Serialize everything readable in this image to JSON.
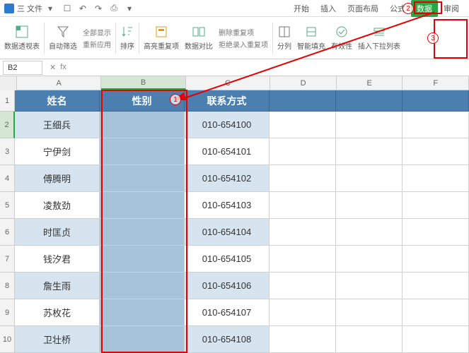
{
  "topbar": {
    "file_menu": "三 文件",
    "tabs": [
      "开始",
      "插入",
      "页面布局",
      "公式",
      "数据",
      "审阅"
    ],
    "active_tab": "数据"
  },
  "ribbon": {
    "pivot": "数据透视表",
    "autofilter": "自动筛选",
    "show_all": "全部显示",
    "reapply": "重新应用",
    "sort": "排序",
    "highlight_dup": "高亮重复项",
    "data_compare": "数据对比",
    "del_dup": "删除重复项",
    "reject_dup": "拒绝录入重复项",
    "split_col": "分列",
    "smart_fill": "智能填充",
    "validity": "有效性",
    "insert_dropdown": "插入下拉列表"
  },
  "formula_bar": {
    "name_box": "B2"
  },
  "columns": [
    "A",
    "B",
    "C",
    "D",
    "E",
    "F"
  ],
  "table": {
    "headers": [
      "姓名",
      "性别",
      "联系方式"
    ],
    "rows": [
      {
        "name": "王细兵",
        "gender": "",
        "phone": "010-654100"
      },
      {
        "name": "宁伊剑",
        "gender": "",
        "phone": "010-654101"
      },
      {
        "name": "傅腾明",
        "gender": "",
        "phone": "010-654102"
      },
      {
        "name": "凌敖劲",
        "gender": "",
        "phone": "010-654103"
      },
      {
        "name": "时匡贞",
        "gender": "",
        "phone": "010-654104"
      },
      {
        "name": "钱汐君",
        "gender": "",
        "phone": "010-654105"
      },
      {
        "name": "詹生雨",
        "gender": "",
        "phone": "010-654106"
      },
      {
        "name": "苏枚花",
        "gender": "",
        "phone": "010-654107"
      },
      {
        "name": "卫壮桥",
        "gender": "",
        "phone": "010-654108"
      }
    ]
  },
  "callouts": {
    "c1": "1",
    "c2": "2",
    "c3": "3"
  }
}
